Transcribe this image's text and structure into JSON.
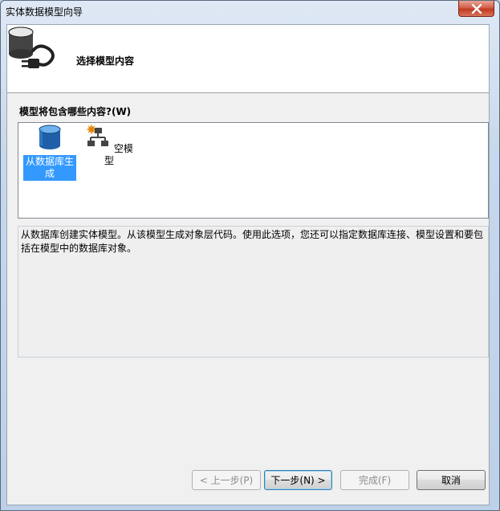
{
  "window": {
    "title": "实体数据模型向导"
  },
  "header": {
    "title": "选择模型内容",
    "icon": "database-plug-icon"
  },
  "content": {
    "question": "模型将包含哪些内容?(W)",
    "items": [
      {
        "label": "从数据库生成",
        "icon": "database-icon",
        "selected": true
      },
      {
        "label": "空模型",
        "icon": "empty-model-icon",
        "selected": false
      }
    ],
    "description": "从数据库创建实体模型。从该模型生成对象层代码。使用此选项，您还可以指定数据库连接、模型设置和要包括在模型中的数据库对象。"
  },
  "buttons": {
    "prev": "< 上一步(P)",
    "next": "下一步(N) >",
    "finish": "完成(F)",
    "cancel": "取消"
  },
  "colors": {
    "selection": "#3399ff",
    "close": "#c13a20"
  }
}
